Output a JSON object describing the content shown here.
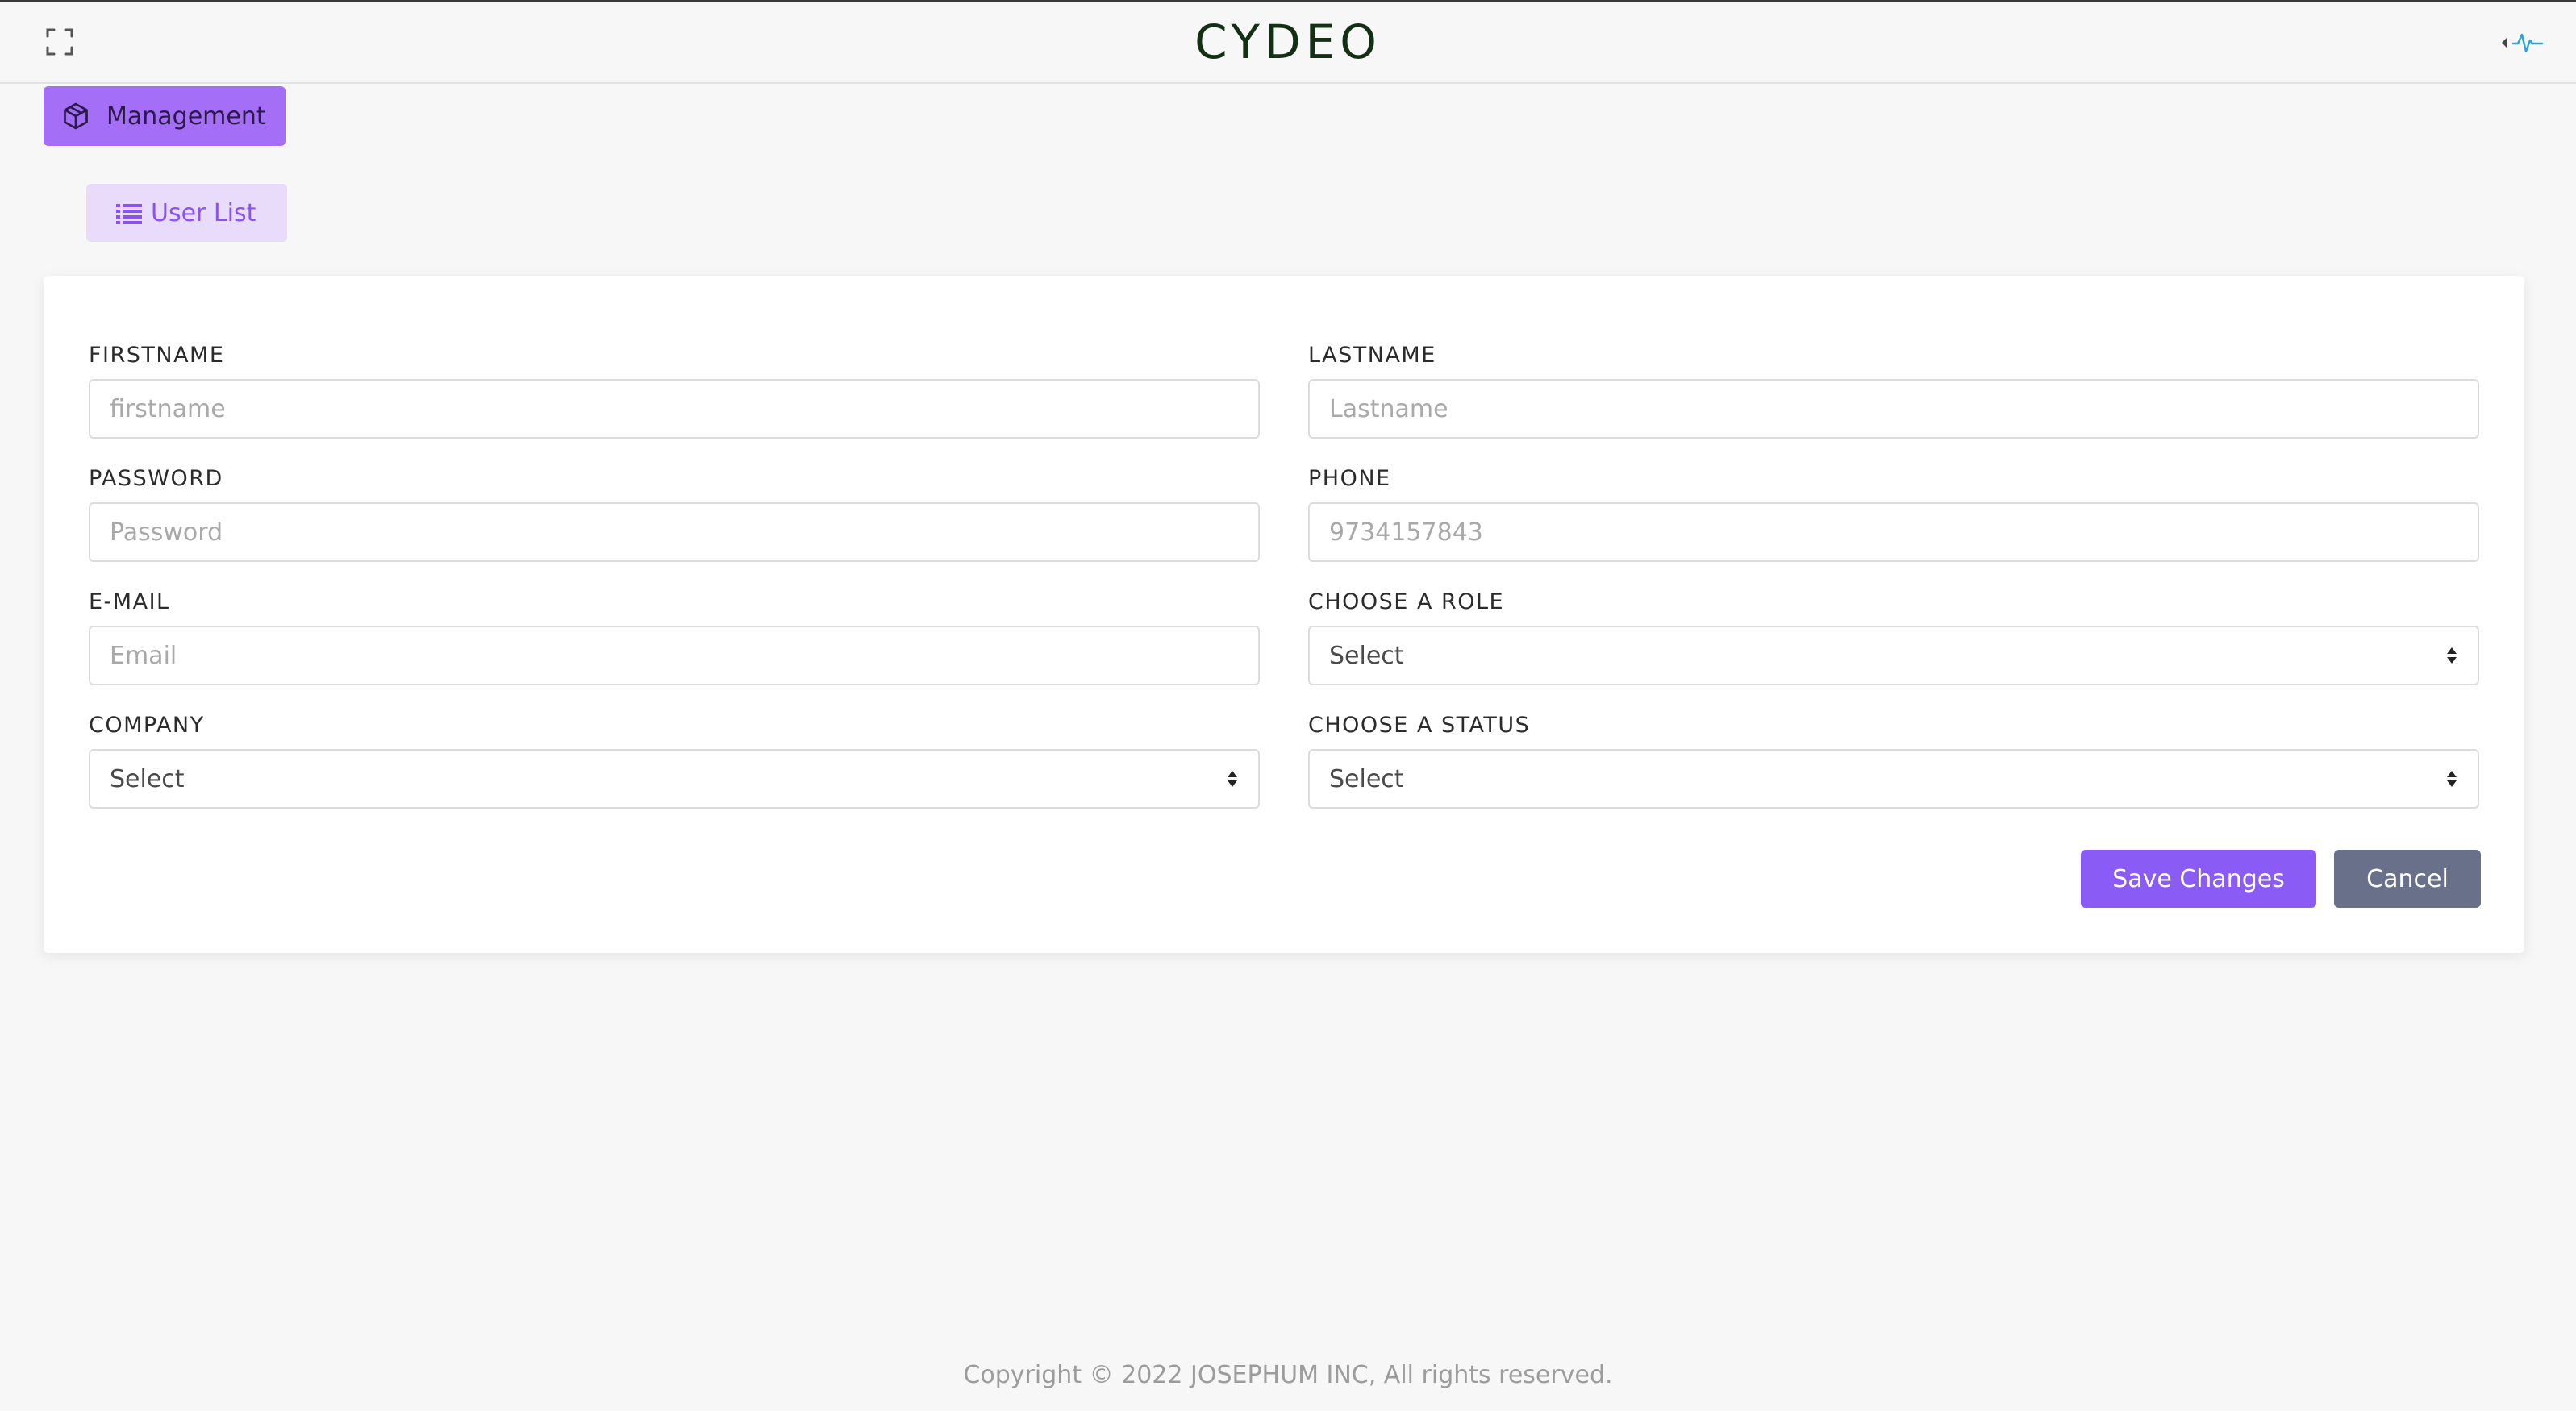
{
  "header": {
    "brand": "CYDEO",
    "expand_icon": "expand-icon",
    "activity_icon": "activity-icon"
  },
  "nav": {
    "management_label": "Management",
    "management_icon": "box-icon",
    "user_list_label": "User List",
    "user_list_icon": "list-icon"
  },
  "form": {
    "firstname": {
      "label": "FIRSTNAME",
      "placeholder": "firstname",
      "value": ""
    },
    "lastname": {
      "label": "LASTNAME",
      "placeholder": "Lastname",
      "value": ""
    },
    "password": {
      "label": "PASSWORD",
      "placeholder": "Password",
      "value": ""
    },
    "phone": {
      "label": "PHONE",
      "placeholder": "9734157843",
      "value": ""
    },
    "email": {
      "label": "E-MAIL",
      "placeholder": "Email",
      "value": ""
    },
    "role": {
      "label": "CHOOSE A ROLE",
      "selected": "Select"
    },
    "company": {
      "label": "COMPANY",
      "selected": "Select"
    },
    "status": {
      "label": "CHOOSE A STATUS",
      "selected": "Select"
    },
    "save_label": "Save Changes",
    "cancel_label": "Cancel"
  },
  "footer": {
    "copyright": "Copyright © 2022  JOSEPHUM INC, All rights reserved."
  },
  "colors": {
    "accent": "#8a5cf5",
    "management_bg": "#a56ef6",
    "user_list_bg": "#e9dcfb",
    "cancel_bg": "#69708a",
    "brand_text": "#133015"
  }
}
